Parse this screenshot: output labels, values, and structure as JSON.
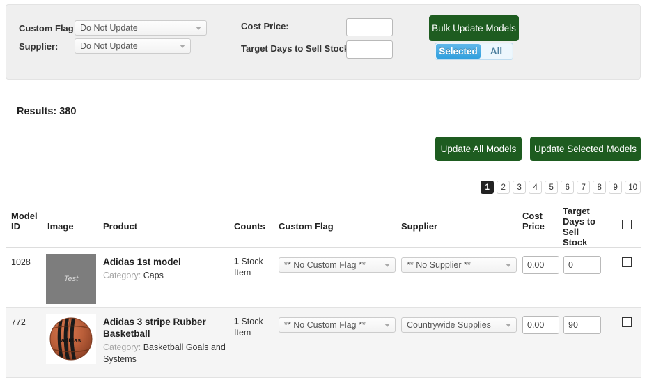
{
  "bulk_panel": {
    "custom_flag_label": "Custom Flag:",
    "custom_flag_value": "Do Not Update",
    "supplier_label": "Supplier:",
    "supplier_value": "Do Not Update",
    "cost_price_label": "Cost Price:",
    "cost_price_value": "",
    "cost_price_placeholder": "",
    "target_days_label": "Target Days to Sell Stock:",
    "target_days_value": "",
    "target_days_placeholder": "",
    "bulk_update_button": "Bulk Update Models",
    "scope_toggle": {
      "selected_label": "Selected",
      "all_label": "All",
      "active": "Selected"
    }
  },
  "results": {
    "label": "Results: 380"
  },
  "actions": {
    "update_all": "Update All Models",
    "update_selected": "Update Selected Models"
  },
  "pagination": {
    "pages": [
      "1",
      "2",
      "3",
      "4",
      "5",
      "6",
      "7",
      "8",
      "9",
      "10"
    ],
    "current": "1"
  },
  "table": {
    "headers": {
      "model_id": "Model ID",
      "image": "Image",
      "product": "Product",
      "counts": "Counts",
      "custom_flag": "Custom Flag",
      "supplier": "Supplier",
      "cost_price": "Cost Price",
      "target_days": "Target Days to Sell Stock",
      "select_all": ""
    },
    "rows": [
      {
        "model_id": "1028",
        "image_type": "placeholder",
        "image_text": "Test",
        "product_name": "Adidas 1st model",
        "category_label": "Category:",
        "category_value": "Caps",
        "counts_number": "1",
        "counts_text": "Stock Item",
        "custom_flag": "** No Custom Flag **",
        "supplier": "** No Supplier **",
        "cost_price": "0.00",
        "target_days": "0",
        "selected": false
      },
      {
        "model_id": "772",
        "image_type": "basketball",
        "image_text": "adidas",
        "product_name": "Adidas 3 stripe Rubber Basketball",
        "category_label": "Category:",
        "category_value": "Basketball Goals and Systems",
        "counts_number": "1",
        "counts_text": "Stock Item",
        "custom_flag": "** No Custom Flag **",
        "supplier": "Countrywide Supplies",
        "cost_price": "0.00",
        "target_days": "90",
        "selected": false
      }
    ]
  },
  "colors": {
    "green_button": "#1e5c20",
    "toggle_active": "#31a0de",
    "panel_bg": "#efefef",
    "row_alt_bg": "#f5f5f5",
    "pager_active": "#222222"
  }
}
